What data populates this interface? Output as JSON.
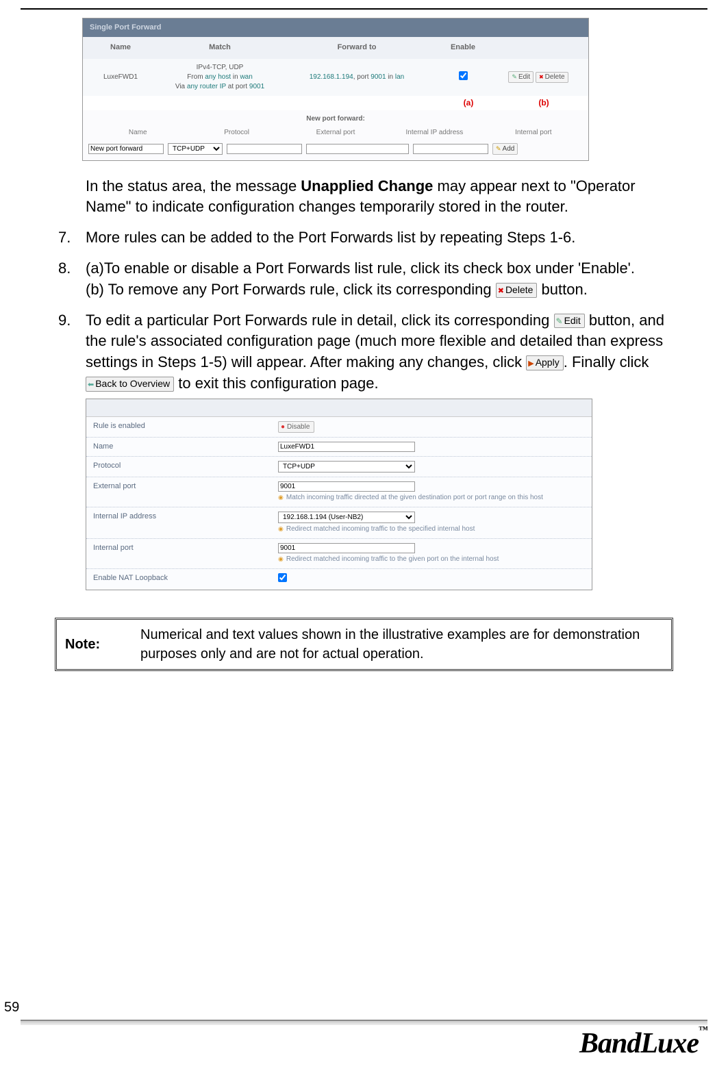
{
  "screenshot1": {
    "panel_title": "Single Port Forward",
    "headers": {
      "name": "Name",
      "match": "Match",
      "fwd": "Forward to",
      "enable": "Enable"
    },
    "row": {
      "name": "LuxeFWD1",
      "match_line1": "IPv4-TCP, UDP",
      "match_line2_a": "From ",
      "match_line2_b": "any host",
      "match_line2_c": " in ",
      "match_line2_d": "wan",
      "match_line3_a": "Via ",
      "match_line3_b": "any router IP",
      "match_line3_c": " at port ",
      "match_line3_d": "9001",
      "fwd_a": "192.168.1.194",
      "fwd_b": ", port ",
      "fwd_c": "9001",
      "fwd_d": " in ",
      "fwd_e": "lan",
      "edit": "Edit",
      "delete": "Delete"
    },
    "ab": {
      "a": "(a)",
      "b": "(b)"
    },
    "npf_title": "New port forward:",
    "npf_headers": {
      "name": "Name",
      "protocol": "Protocol",
      "ext": "External port",
      "int_ip": "Internal IP address",
      "int_port": "Internal port"
    },
    "npf_inputs": {
      "name": "New port forward",
      "protocol": "TCP+UDP",
      "add": "Add"
    }
  },
  "para1_a": "In the status area, the message ",
  "para1_b": "Unapplied Change",
  "para1_c": " may appear next to \"Operator Name\" to indicate configuration changes temporarily stored in the router.",
  "item7": "More rules can be added to the Port Forwards list by repeating Steps 1-6.",
  "item8_a": "(a)To enable or disable a Port Forwards list rule, click its check box under 'Enable'.",
  "item8_b": "(b) To remove any Port Forwards rule, click its corresponding ",
  "item8_delete": "Delete",
  "item8_c": " button.",
  "item9_a": "To edit a particular Port Forwards rule in detail, click its corresponding ",
  "item9_edit": "Edit",
  "item9_b": " button, and the rule's associated configuration page (much more flexible and detailed than express settings in Steps 1-5) will appear. After making any changes, click ",
  "item9_apply": "Apply",
  "item9_c": ". Finally click ",
  "item9_back": "Back to Overview",
  "item9_d": " to exit this configuration page.",
  "num7": "7.",
  "num8": "8.",
  "num9": "9.",
  "screenshot2": {
    "rows": {
      "rule": {
        "label": "Rule is enabled",
        "btn": "Disable"
      },
      "name": {
        "label": "Name",
        "value": "LuxeFWD1"
      },
      "protocol": {
        "label": "Protocol",
        "value": "TCP+UDP"
      },
      "ext": {
        "label": "External port",
        "value": "9001",
        "hint": "Match incoming traffic directed at the given destination port or port range on this host"
      },
      "intip": {
        "label": "Internal IP address",
        "value": "192.168.1.194 (User-NB2)",
        "hint": "Redirect matched incoming traffic to the specified internal host"
      },
      "intport": {
        "label": "Internal port",
        "value": "9001",
        "hint": "Redirect matched incoming traffic to the given port on the internal host"
      },
      "nat": {
        "label": "Enable NAT Loopback"
      }
    }
  },
  "note_label": "Note:",
  "note_text": "Numerical and text values shown in the illustrative examples are for demonstration purposes only and are not for actual operation.",
  "page_number": "59",
  "brand": "BandLuxe",
  "tm": "™"
}
